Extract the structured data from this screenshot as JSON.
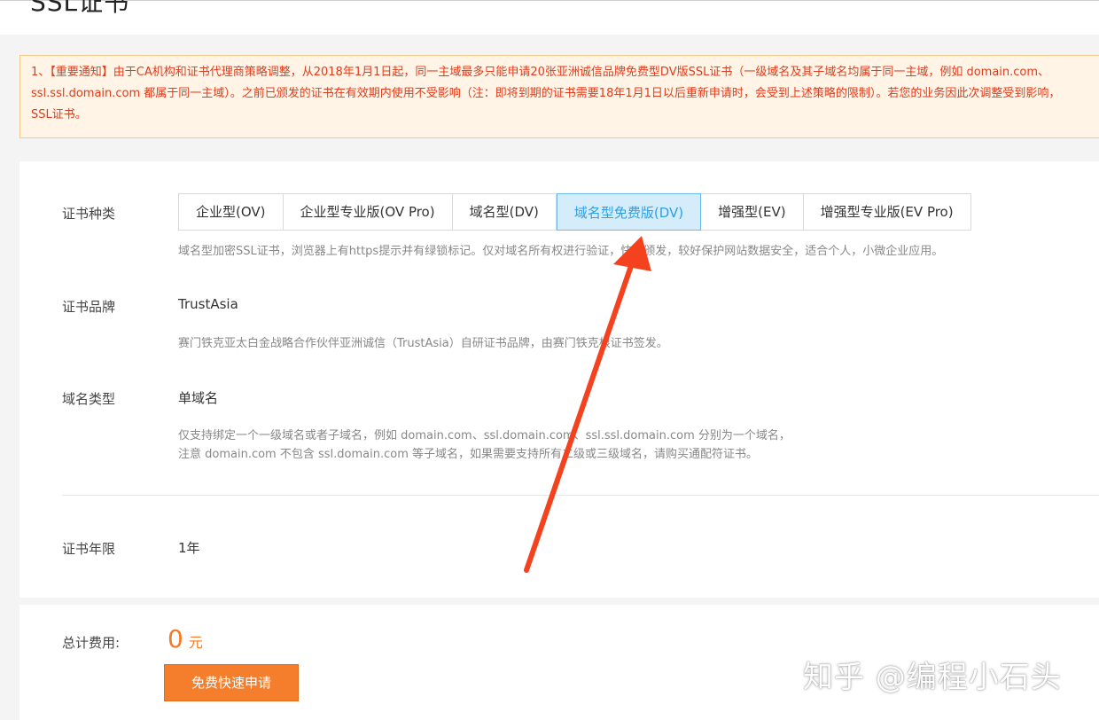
{
  "page": {
    "title": "SSL证书"
  },
  "notice": {
    "line1": "1、【重要通知】由于CA机构和证书代理商策略调整，从2018年1月1日起，同一主域最多只能申请20张亚洲诚信品牌免费型DV版SSL证书（一级域名及其子域名均属于同一主域，例如 domain.com、",
    "line2": "ssl.ssl.domain.com 都属于同一主域）。之前已颁发的证书在有效期内使用不受影响（注：即将到期的证书需要18年1月1日以后重新申请时，会受到上述策略的限制）。若您的业务因此次调整受到影响，",
    "line3": "SSL证书。"
  },
  "cert_type": {
    "label": "证书种类",
    "tabs": [
      {
        "label": "企业型(OV)"
      },
      {
        "label": "企业型专业版(OV Pro)"
      },
      {
        "label": "域名型(DV)"
      },
      {
        "label": "域名型免费版(DV)"
      },
      {
        "label": "增强型(EV)"
      },
      {
        "label": "增强型专业版(EV Pro)"
      }
    ],
    "active_index": 3,
    "description": "域名型加密SSL证书，浏览器上有https提示并有绿锁标记。仅对域名所有权进行验证，快速颁发，较好保护网站数据安全，适合个人，小微企业应用。"
  },
  "cert_brand": {
    "label": "证书品牌",
    "value": "TrustAsia",
    "description": "赛门铁克亚太白金战略合作伙伴亚洲诚信（TrustAsia）自研证书品牌，由赛门铁克根证书签发。"
  },
  "domain_type": {
    "label": "域名类型",
    "value": "单域名",
    "description_line1": "仅支持绑定一个一级域名或者子域名，例如 domain.com、ssl.domain.com、ssl.ssl.domain.com 分别为一个域名，",
    "description_line2": "注意 domain.com 不包含 ssl.domain.com 等子域名，如果需要支持所有二级或三级域名，请购买通配符证书。"
  },
  "cert_period": {
    "label": "证书年限",
    "value": "1年"
  },
  "footer": {
    "total_label": "总计费用:",
    "price": "0",
    "unit": "元",
    "apply_button": "免费快速申请"
  },
  "watermark": "知乎 @编程小石头",
  "colors": {
    "accent": "#2d9fe6",
    "orange": "#f57a26",
    "notice_text": "#e03b1c",
    "arrow": "#f5421e"
  }
}
